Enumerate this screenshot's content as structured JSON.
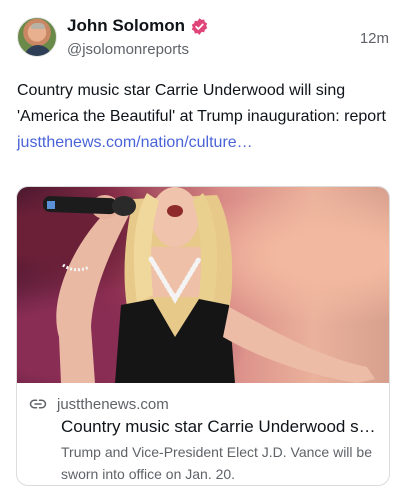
{
  "post": {
    "author": {
      "display_name": "John Solomon",
      "handle": "@jsolomonreports",
      "verified": true,
      "avatar_icon": "avatar-photo"
    },
    "timestamp": "12m",
    "text_before_link": "Country music star Carrie Underwood will sing 'America the Beautiful' at Trump inauguration: report ",
    "link_text": "justthenews.com/nation/culture…",
    "link_color": "#4a63d8",
    "verified_color": "#e0457a"
  },
  "card": {
    "image_icon": "singer-photo",
    "domain_icon": "link-icon",
    "domain": "justthenews.com",
    "title": "Country music star Carrie Underwood sings 'America the Beautiful'",
    "description": "Trump and Vice-President Elect J.D. Vance will be sworn into office on Jan. 20."
  }
}
